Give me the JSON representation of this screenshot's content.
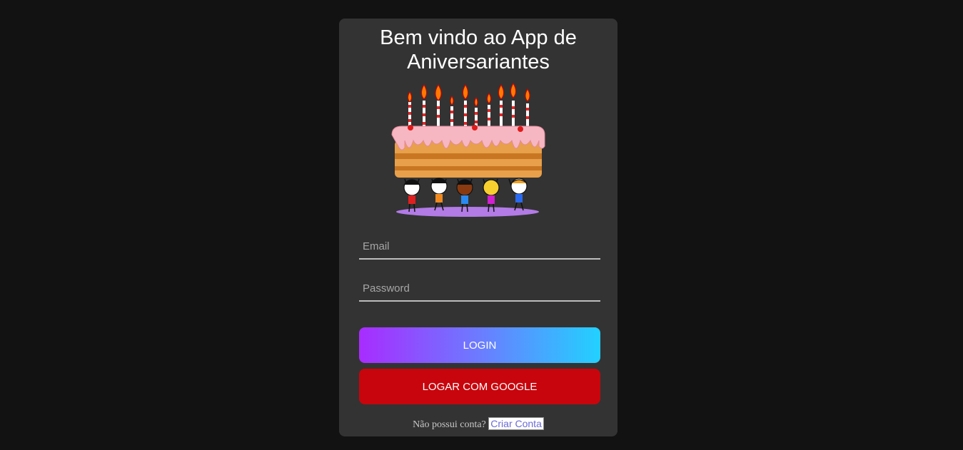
{
  "header": {
    "title_line1": "Bem vindo ao App de",
    "title_line2": "Aniversariantes"
  },
  "image": {
    "icon": "birthday-cake-illustration"
  },
  "form": {
    "email_placeholder": "Email",
    "email_value": "",
    "password_placeholder": "Password",
    "password_value": ""
  },
  "buttons": {
    "login_label": "LOGIN",
    "google_label": "LOGAR COM GOOGLE"
  },
  "footer": {
    "prompt": "Não possui conta?",
    "link_label": "Criar Conta"
  },
  "colors": {
    "background": "#121212",
    "card": "#333333",
    "google_button": "#c8050c",
    "gradient_start": "#a82cff",
    "gradient_end": "#22d1ff"
  }
}
